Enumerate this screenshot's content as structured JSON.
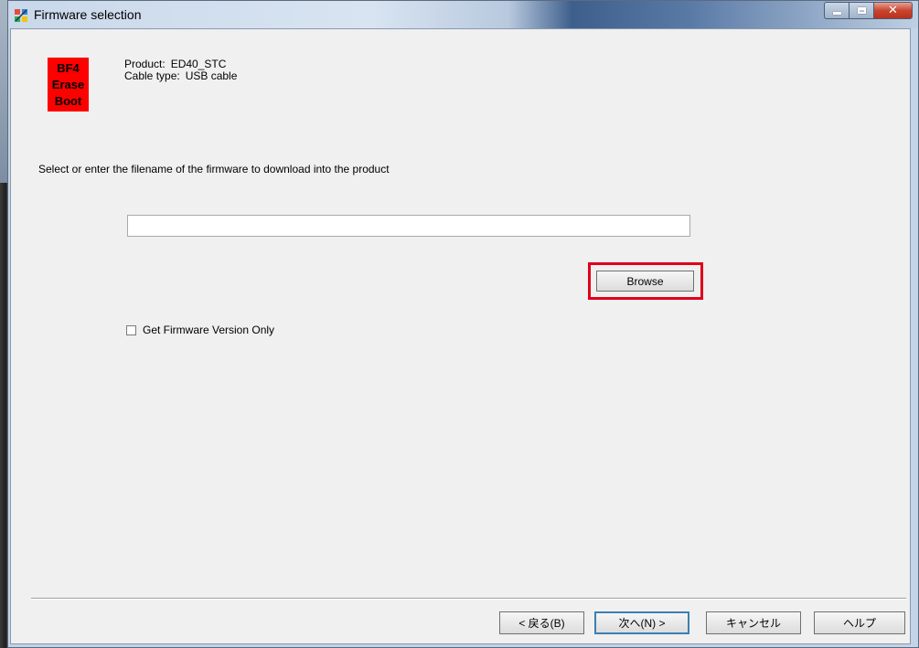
{
  "window": {
    "title": "Firmware selection"
  },
  "product_badge": {
    "line1": "BF4",
    "line2": "Erase",
    "line3": "Boot"
  },
  "info": {
    "product_label": "Product:",
    "product_value": "ED40_STC",
    "cable_label": "Cable type:",
    "cable_value": "USB cable"
  },
  "instruction": "Select or enter the filename of the firmware to download into the product",
  "file_input": {
    "value": ""
  },
  "browse_label": "Browse",
  "checkbox": {
    "label": "Get Firmware Version Only",
    "checked": false
  },
  "footer": {
    "back_label": "< 戻る(B)",
    "next_label": "次へ(N) >",
    "cancel_label": "キャンセル",
    "help_label": "ヘルプ"
  },
  "colors": {
    "badge": "#ff0000",
    "highlight": "#e0001a",
    "dialog_bg": "#f0f0f0",
    "title_bar": "#c9d8ea"
  },
  "icons": {
    "app": "app-icon",
    "minimize": "minimize-icon",
    "maximize": "maximize-icon",
    "close": "close-icon"
  }
}
